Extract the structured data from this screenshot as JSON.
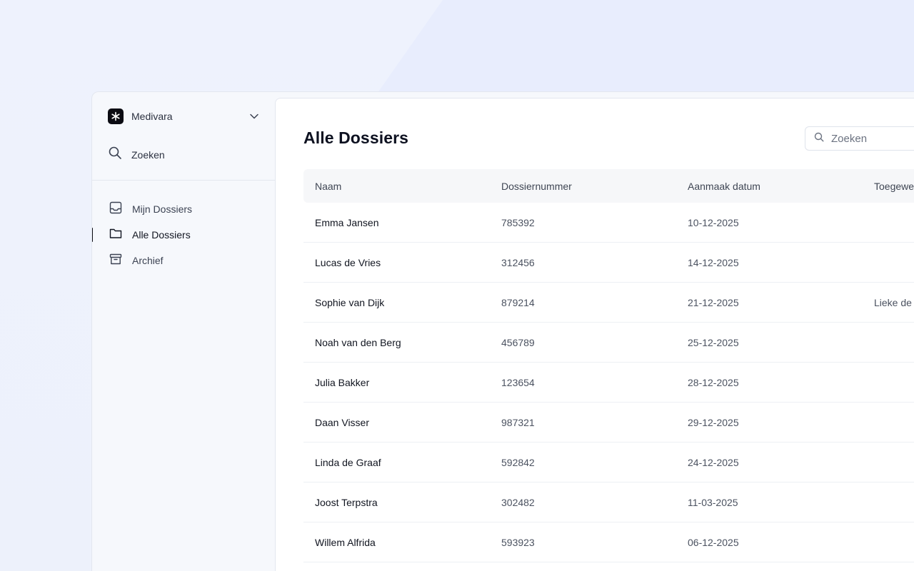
{
  "org": {
    "name": "Medivara"
  },
  "sidebar": {
    "search_label": "Zoeken",
    "items": [
      {
        "label": "Mijn Dossiers",
        "icon": "inbox-icon",
        "active": false
      },
      {
        "label": "Alle Dossiers",
        "icon": "folder-icon",
        "active": true
      },
      {
        "label": "Archief",
        "icon": "archive-icon",
        "active": false
      }
    ]
  },
  "main": {
    "title": "Alle Dossiers",
    "search": {
      "placeholder": "Zoeken",
      "value": ""
    },
    "table": {
      "columns": [
        "Naam",
        "Dossiernummer",
        "Aanmaak datum",
        "Toegewe"
      ],
      "rows": [
        {
          "name": "Emma Jansen",
          "number": "785392",
          "date": "10-12-2025",
          "assigned": ""
        },
        {
          "name": "Lucas de Vries",
          "number": "312456",
          "date": "14-12-2025",
          "assigned": ""
        },
        {
          "name": "Sophie van Dijk",
          "number": "879214",
          "date": "21-12-2025",
          "assigned": "Lieke de"
        },
        {
          "name": "Noah van den Berg",
          "number": "456789",
          "date": "25-12-2025",
          "assigned": ""
        },
        {
          "name": "Julia Bakker",
          "number": "123654",
          "date": "28-12-2025",
          "assigned": ""
        },
        {
          "name": "Daan Visser",
          "number": "987321",
          "date": "29-12-2025",
          "assigned": ""
        },
        {
          "name": "Linda de Graaf",
          "number": "592842",
          "date": "24-12-2025",
          "assigned": ""
        },
        {
          "name": "Joost Terpstra",
          "number": "302482",
          "date": "11-03-2025",
          "assigned": ""
        },
        {
          "name": "Willem Alfrida",
          "number": "593923",
          "date": "06-12-2025",
          "assigned": ""
        }
      ]
    }
  }
}
